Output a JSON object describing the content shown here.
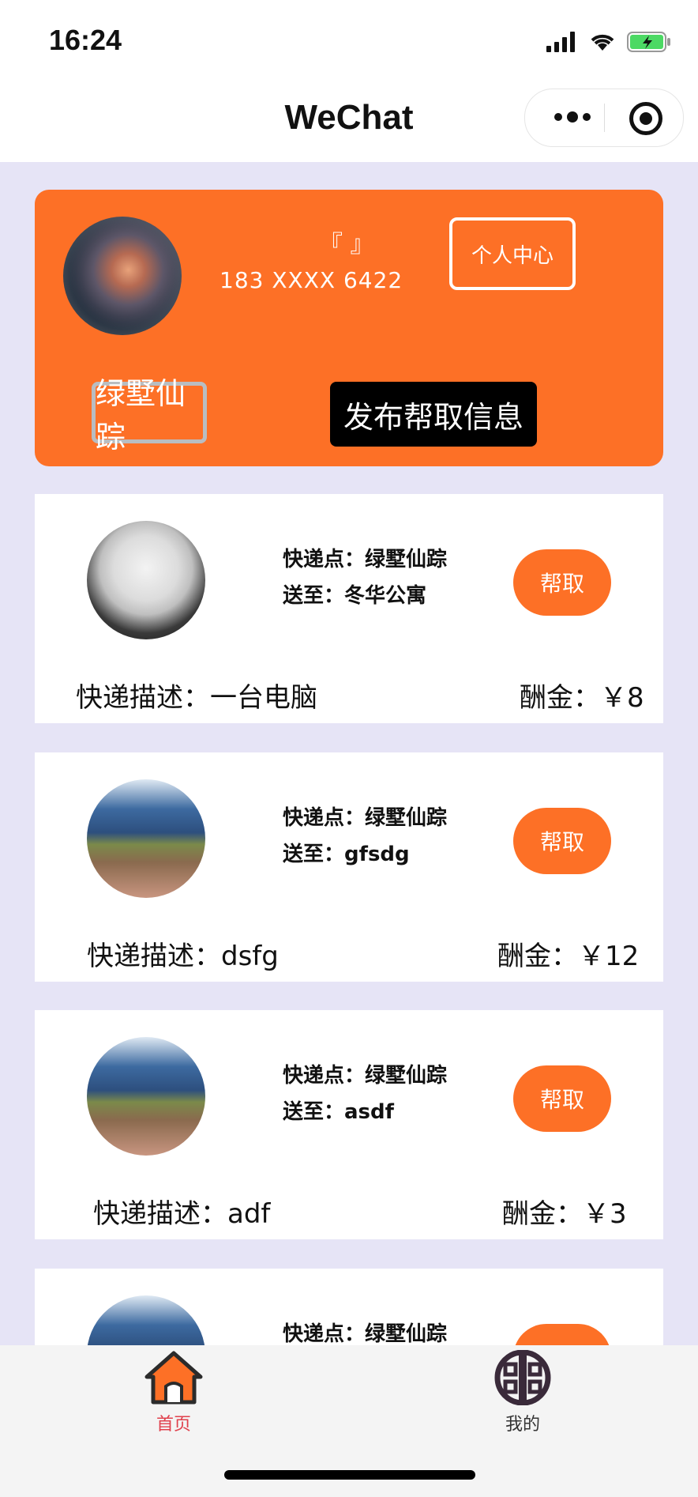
{
  "status_bar": {
    "time": "16:24"
  },
  "nav": {
    "title": "WeChat"
  },
  "profile": {
    "nickname": "『 』",
    "phone": "183 XXXX 6422",
    "center_button": "个人中心",
    "location_button": "绿墅仙踪",
    "publish_button": "发布帮取信息"
  },
  "orders": [
    {
      "pickup": "快递点：绿墅仙踪",
      "deliver_label": "送至：",
      "deliver_value": "冬华公寓",
      "help": "帮取",
      "desc": "快递描述：一台电脑",
      "reward": "酬金：￥8"
    },
    {
      "pickup": "快递点：绿墅仙踪",
      "deliver_label": "送至：",
      "deliver_value": "gfsdg",
      "help": "帮取",
      "desc": "快递描述：dsfg",
      "reward": "酬金：￥12"
    },
    {
      "pickup": "快递点：绿墅仙踪",
      "deliver_label": "送至：",
      "deliver_value": "asdf",
      "help": "帮取",
      "desc": "快递描述：adf",
      "reward": "酬金：￥3"
    },
    {
      "pickup": "快递点：绿墅仙踪"
    }
  ],
  "tabbar": {
    "home": {
      "label": "首页",
      "icon": "home-icon",
      "color": "#e0404c"
    },
    "mine": {
      "label": "我的",
      "icon": "mine-icon",
      "color": "#333333"
    }
  },
  "colors": {
    "accent": "#fd7026",
    "background": "#e6e4f6"
  }
}
